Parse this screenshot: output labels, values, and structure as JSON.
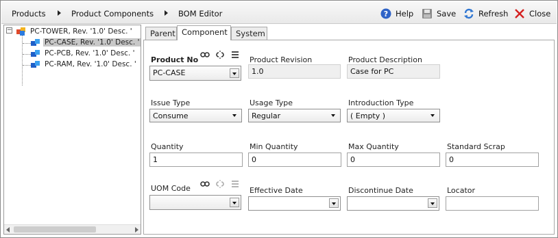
{
  "breadcrumb": [
    "Products",
    "Product Components",
    "BOM Editor"
  ],
  "toolbar": {
    "help": "Help",
    "save": "Save",
    "refresh": "Refresh",
    "close": "Close"
  },
  "tree": {
    "root": "PC-TOWER, Rev. '1.0' Desc. '",
    "children": [
      "PC-CASE, Rev. '1.0' Desc. '",
      "PC-PCB, Rev. '1.0' Desc. '",
      "PC-RAM, Rev. '1.0' Desc. '"
    ]
  },
  "tabs": [
    "Parent",
    "Component",
    "System"
  ],
  "active_tab": "Component",
  "form": {
    "product_no": {
      "label": "Product No",
      "value": "PC-CASE"
    },
    "product_revision": {
      "label": "Product Revision",
      "value": "1.0"
    },
    "product_description": {
      "label": "Product Description",
      "value": "Case for PC"
    },
    "issue_type": {
      "label": "Issue Type",
      "value": "Consume"
    },
    "usage_type": {
      "label": "Usage Type",
      "value": "Regular"
    },
    "introduction_type": {
      "label": "Introduction Type",
      "value": "( Empty )"
    },
    "quantity": {
      "label": "Quantity",
      "value": "1"
    },
    "min_quantity": {
      "label": "Min Quantity",
      "value": "0"
    },
    "max_quantity": {
      "label": "Max Quantity",
      "value": "0"
    },
    "standard_scrap": {
      "label": "Standard Scrap",
      "value": "0"
    },
    "uom_code": {
      "label": "UOM Code",
      "value": ""
    },
    "effective_date": {
      "label": "Effective Date",
      "value": ""
    },
    "discontinue_date": {
      "label": "Discontinue Date",
      "value": ""
    },
    "locator": {
      "label": "Locator",
      "value": ""
    }
  },
  "icons": {
    "help": "help-icon",
    "save": "save-icon",
    "refresh": "refresh-icon",
    "close": "close-icon",
    "link": "link-icon",
    "unlink": "unlink-icon",
    "list": "list-icon"
  },
  "colors": {
    "help_blue": "#2f63c7",
    "close_red": "#d42020",
    "selection": "#c8c8c8"
  }
}
